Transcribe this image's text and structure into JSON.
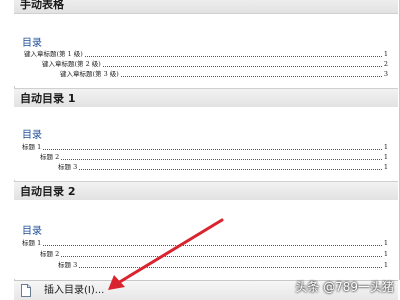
{
  "sections": [
    {
      "header": "手动表格",
      "toc_title": "目录",
      "entries": [
        {
          "text": "键入章标题(第 1 级)",
          "page": "1"
        },
        {
          "text": "键入章标题(第 2 级)",
          "page": "2"
        },
        {
          "text": "键入章标题(第 3 级)",
          "page": "3"
        }
      ]
    },
    {
      "header": "自动目录 1",
      "toc_title": "目录",
      "entries": [
        {
          "text": "标题 1",
          "page": "1"
        },
        {
          "text": "标题 2",
          "page": "1"
        },
        {
          "text": "标题 3",
          "page": "1"
        }
      ]
    },
    {
      "header": "自动目录 2",
      "toc_title": "目录",
      "entries": [
        {
          "text": "标题 1",
          "page": "1"
        },
        {
          "text": "标题 2",
          "page": "1"
        },
        {
          "text": "标题 3",
          "page": "1"
        }
      ]
    }
  ],
  "bottom_bar": {
    "insert_toc_label": "插入目录(I)...",
    "icon": "document-icon"
  },
  "watermark": "头条 @789一头猪",
  "colors": {
    "arrow": "#d9232e",
    "heading_blue": "#1f4e9a",
    "header_bg": "#e8e8e8"
  }
}
